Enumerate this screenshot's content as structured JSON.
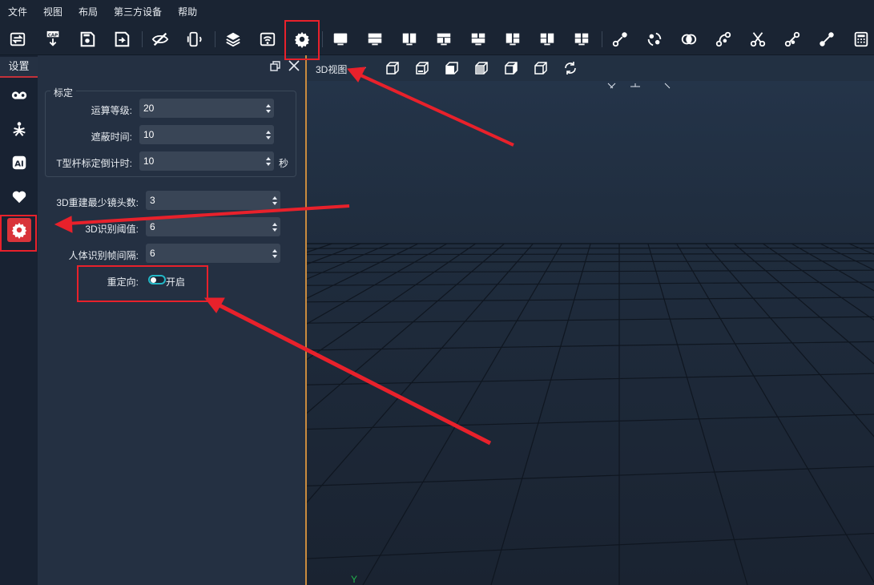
{
  "menu": [
    "文件",
    "视图",
    "布局",
    "第三方设备",
    "帮助"
  ],
  "toolbar": {
    "icons": [
      "swap-icon",
      "cap-download-icon",
      "save-icon",
      "save-as-icon",
      "hide-icon",
      "device-connect-icon",
      "layers-icon",
      "wifi-stream-icon",
      "settings-gear-icon",
      "monitor-single-icon",
      "layout-horizontal-icon",
      "layout-vertical-icon",
      "layout-grid-icon",
      "layout-t-icon",
      "layout-split-icon",
      "layout-split-2-icon",
      "layout-quad-icon",
      "link-nodes-icon",
      "rotate-nodes-icon",
      "merge-icon",
      "curve-nodes-icon",
      "scissors-icon",
      "link-node-2-icon",
      "connect-icon",
      "calculator-icon"
    ]
  },
  "sidebar": {
    "tab_label": "设置",
    "icons": [
      "camera-icon",
      "skeleton-icon",
      "ai-icon",
      "heart-icon",
      "gear-icon"
    ]
  },
  "panel": {
    "group_title": "标定",
    "fields": [
      {
        "label": "运算等级:",
        "value": "20"
      },
      {
        "label": "遮蔽时间:",
        "value": "10"
      },
      {
        "label": "T型杆标定倒计时:",
        "value": "10",
        "unit": "秒"
      },
      {
        "label": "3D重建最少镜头数:",
        "value": "3"
      },
      {
        "label": "3D识别阈值:",
        "value": "6"
      },
      {
        "label": "人体识别帧间隔:",
        "value": "6"
      }
    ],
    "toggle": {
      "label": "重定向:",
      "state_label": "开启",
      "on": true
    }
  },
  "viewport": {
    "title": "3D视图",
    "view_icons": [
      "view-cube-front-icon",
      "view-cube-top-icon",
      "view-cube-iso-icon",
      "view-cube-left-icon",
      "view-cube-right-icon",
      "view-cube-back-icon",
      "reset-view-icon"
    ],
    "axis_label": "Y"
  },
  "colors": {
    "annotation": "#e8212b",
    "accent_active": "#d9343a",
    "toggle": "#23b7c6",
    "divider": "#c98b3e",
    "axis_y": "#22b14c"
  }
}
